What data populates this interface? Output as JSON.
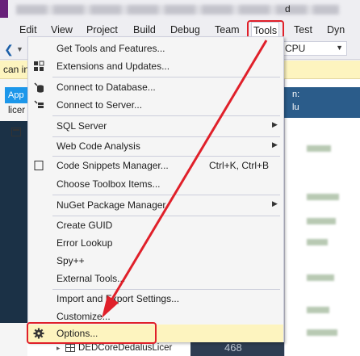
{
  "menubar": {
    "items": [
      {
        "label": "Edit"
      },
      {
        "label": "View"
      },
      {
        "label": "Project"
      },
      {
        "label": "Build"
      },
      {
        "label": "Debug"
      },
      {
        "label": "Team"
      },
      {
        "label": "Tools"
      },
      {
        "label": "Test"
      },
      {
        "label": "Dyn"
      }
    ]
  },
  "toolbar": {
    "platform": "CPU"
  },
  "infobar": {
    "text_left": "can in",
    "text_right": "d"
  },
  "left_panel": {
    "tab_label": "App",
    "search_text": "licer"
  },
  "right_panel": {
    "header_line1": "n:",
    "header_line2": "lu"
  },
  "tools_menu": {
    "items": [
      {
        "label": "Get Tools and Features...",
        "shortcut": "",
        "icon": "none"
      },
      {
        "label": "Extensions and Updates...",
        "shortcut": "",
        "icon": "extensions-icon"
      },
      {
        "label": "Connect to Database...",
        "shortcut": "",
        "icon": "database-icon"
      },
      {
        "label": "Connect to Server...",
        "shortcut": "",
        "icon": "server-icon"
      },
      {
        "label": "SQL Server",
        "shortcut": "",
        "icon": "none",
        "submenu": true
      },
      {
        "label": "Web Code Analysis",
        "shortcut": "",
        "icon": "none",
        "submenu": true
      },
      {
        "label": "Code Snippets Manager...",
        "shortcut": "Ctrl+K, Ctrl+B",
        "icon": "snippet-icon"
      },
      {
        "label": "Choose Toolbox Items...",
        "shortcut": "",
        "icon": "none"
      },
      {
        "label": "NuGet Package Manager",
        "shortcut": "",
        "icon": "none",
        "submenu": true
      },
      {
        "label": "Create GUID",
        "shortcut": "",
        "icon": "none"
      },
      {
        "label": "Error Lookup",
        "shortcut": "",
        "icon": "none"
      },
      {
        "label": "Spy++",
        "shortcut": "",
        "icon": "none"
      },
      {
        "label": "External Tools...",
        "shortcut": "",
        "icon": "none"
      },
      {
        "label": "Import and Export Settings...",
        "shortcut": "",
        "icon": "none"
      },
      {
        "label": "Customize...",
        "shortcut": "",
        "icon": "none"
      },
      {
        "label": "Options...",
        "shortcut": "",
        "icon": "gear-icon"
      }
    ]
  },
  "solution_tree": {
    "row_label": "DEDCoreDedalusLicer"
  },
  "editor": {
    "line_number": "468"
  },
  "colors": {
    "accent": "#1c97ea",
    "highlight_red": "#e0202a",
    "menu_bg": "#f5f5f5",
    "selected_bg": "#fdf4bf",
    "vs_purple": "#68217a"
  }
}
